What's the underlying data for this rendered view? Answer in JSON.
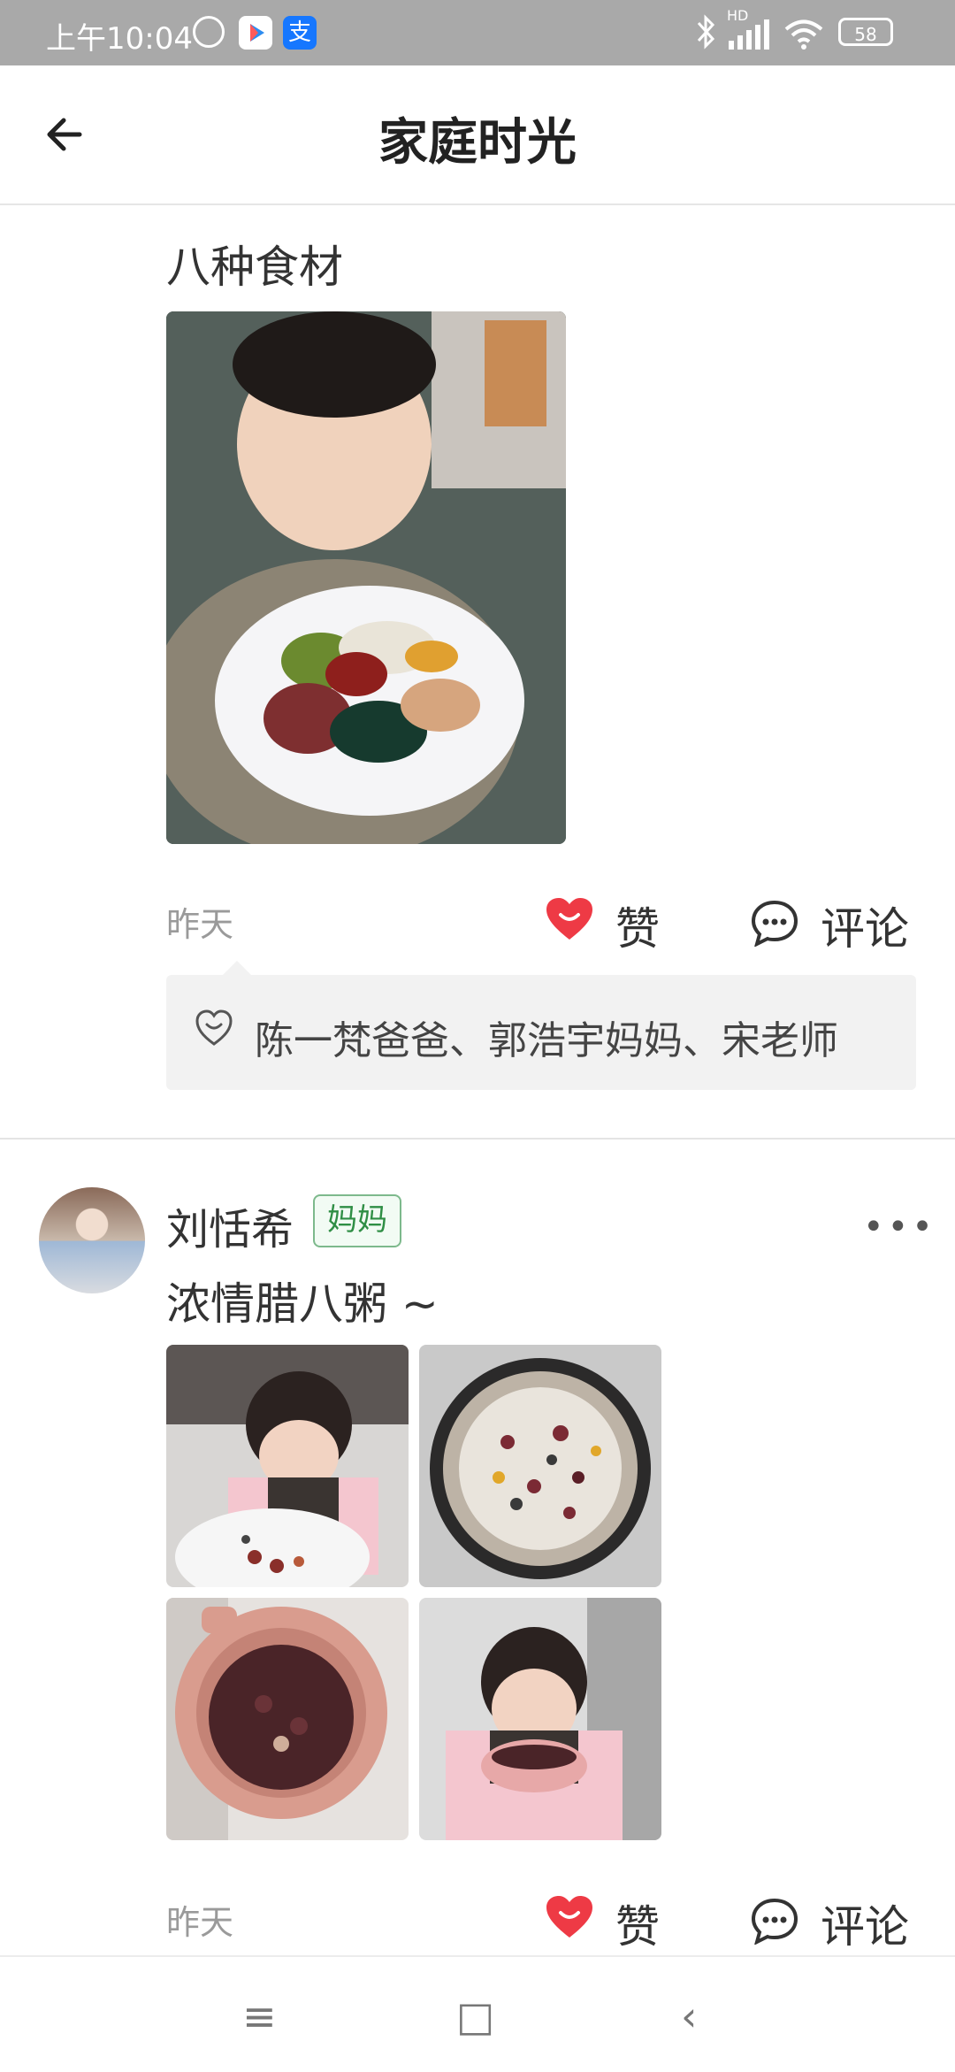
{
  "status_bar": {
    "time": "上午10:04",
    "battery": "58",
    "hd_label": "HD"
  },
  "header": {
    "title": "家庭时光"
  },
  "post1": {
    "text": "八种食材",
    "time": "昨天",
    "like_label": "赞",
    "comment_label": "评论",
    "likes": "陈一梵爸爸、郭浩宇妈妈、宋老师"
  },
  "post2": {
    "author": "刘恬希",
    "role_badge": "妈妈",
    "text": "浓情腊八粥 ~",
    "time": "昨天",
    "like_label": "赞",
    "comment_label": "评论",
    "more": "•••"
  },
  "nav": {
    "menu": "≡",
    "home": "□",
    "back": "‹"
  },
  "colors": {
    "status_bar": "#a9a9a9",
    "like_heart": "#ee3a45",
    "badge_green": "#2f8e45"
  }
}
